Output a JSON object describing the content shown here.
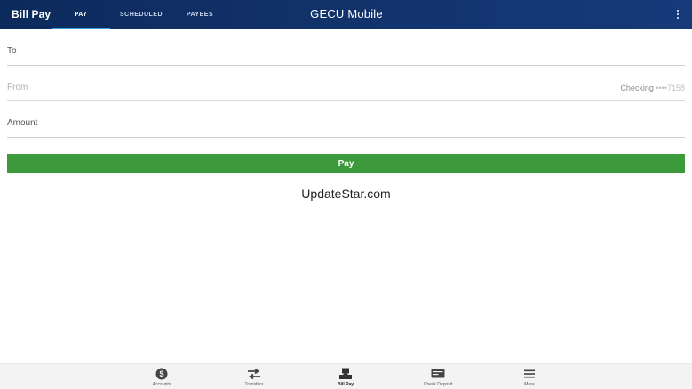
{
  "header": {
    "section_title": "Bill Pay",
    "app_title": "GECU Mobile",
    "tabs": [
      {
        "label": "PAY",
        "active": true
      },
      {
        "label": "SCHEDULED",
        "active": false
      },
      {
        "label": "PAYEES",
        "active": false
      }
    ],
    "more_icon": "vertical-dots-icon"
  },
  "form": {
    "to_label": "To",
    "from_label": "From",
    "from_account": "Checking",
    "from_account_mask": "••••7158",
    "amount_label": "Amount",
    "pay_button": "Pay"
  },
  "watermark": "UpdateStar.com",
  "bottom_nav": [
    {
      "label": "Accounts",
      "icon": "dollar-circle-icon"
    },
    {
      "label": "Transfers",
      "icon": "transfer-arrows-icon"
    },
    {
      "label": "Bill Pay",
      "icon": "bill-pay-icon",
      "active": true
    },
    {
      "label": "Check Deposit",
      "icon": "check-deposit-icon"
    },
    {
      "label": "More",
      "icon": "menu-icon"
    }
  ],
  "colors": {
    "header_bg": "#0d2a5c",
    "tab_indicator": "#3fa0e0",
    "pay_button": "#3c9a3c",
    "nav_icon": "#444444"
  }
}
